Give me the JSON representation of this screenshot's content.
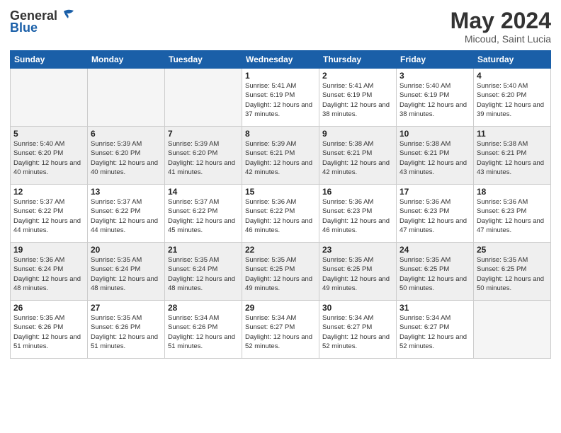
{
  "header": {
    "logo_general": "General",
    "logo_blue": "Blue",
    "month_title": "May 2024",
    "location": "Micoud, Saint Lucia"
  },
  "days_of_week": [
    "Sunday",
    "Monday",
    "Tuesday",
    "Wednesday",
    "Thursday",
    "Friday",
    "Saturday"
  ],
  "weeks": [
    [
      {
        "day": "",
        "info": ""
      },
      {
        "day": "",
        "info": ""
      },
      {
        "day": "",
        "info": ""
      },
      {
        "day": "1",
        "sunrise": "5:41 AM",
        "sunset": "6:19 PM",
        "daylight": "12 hours and 37 minutes."
      },
      {
        "day": "2",
        "sunrise": "5:41 AM",
        "sunset": "6:19 PM",
        "daylight": "12 hours and 38 minutes."
      },
      {
        "day": "3",
        "sunrise": "5:40 AM",
        "sunset": "6:19 PM",
        "daylight": "12 hours and 38 minutes."
      },
      {
        "day": "4",
        "sunrise": "5:40 AM",
        "sunset": "6:20 PM",
        "daylight": "12 hours and 39 minutes."
      }
    ],
    [
      {
        "day": "5",
        "sunrise": "5:40 AM",
        "sunset": "6:20 PM",
        "daylight": "12 hours and 40 minutes."
      },
      {
        "day": "6",
        "sunrise": "5:39 AM",
        "sunset": "6:20 PM",
        "daylight": "12 hours and 40 minutes."
      },
      {
        "day": "7",
        "sunrise": "5:39 AM",
        "sunset": "6:20 PM",
        "daylight": "12 hours and 41 minutes."
      },
      {
        "day": "8",
        "sunrise": "5:39 AM",
        "sunset": "6:21 PM",
        "daylight": "12 hours and 42 minutes."
      },
      {
        "day": "9",
        "sunrise": "5:38 AM",
        "sunset": "6:21 PM",
        "daylight": "12 hours and 42 minutes."
      },
      {
        "day": "10",
        "sunrise": "5:38 AM",
        "sunset": "6:21 PM",
        "daylight": "12 hours and 43 minutes."
      },
      {
        "day": "11",
        "sunrise": "5:38 AM",
        "sunset": "6:21 PM",
        "daylight": "12 hours and 43 minutes."
      }
    ],
    [
      {
        "day": "12",
        "sunrise": "5:37 AM",
        "sunset": "6:22 PM",
        "daylight": "12 hours and 44 minutes."
      },
      {
        "day": "13",
        "sunrise": "5:37 AM",
        "sunset": "6:22 PM",
        "daylight": "12 hours and 44 minutes."
      },
      {
        "day": "14",
        "sunrise": "5:37 AM",
        "sunset": "6:22 PM",
        "daylight": "12 hours and 45 minutes."
      },
      {
        "day": "15",
        "sunrise": "5:36 AM",
        "sunset": "6:22 PM",
        "daylight": "12 hours and 46 minutes."
      },
      {
        "day": "16",
        "sunrise": "5:36 AM",
        "sunset": "6:23 PM",
        "daylight": "12 hours and 46 minutes."
      },
      {
        "day": "17",
        "sunrise": "5:36 AM",
        "sunset": "6:23 PM",
        "daylight": "12 hours and 47 minutes."
      },
      {
        "day": "18",
        "sunrise": "5:36 AM",
        "sunset": "6:23 PM",
        "daylight": "12 hours and 47 minutes."
      }
    ],
    [
      {
        "day": "19",
        "sunrise": "5:36 AM",
        "sunset": "6:24 PM",
        "daylight": "12 hours and 48 minutes."
      },
      {
        "day": "20",
        "sunrise": "5:35 AM",
        "sunset": "6:24 PM",
        "daylight": "12 hours and 48 minutes."
      },
      {
        "day": "21",
        "sunrise": "5:35 AM",
        "sunset": "6:24 PM",
        "daylight": "12 hours and 48 minutes."
      },
      {
        "day": "22",
        "sunrise": "5:35 AM",
        "sunset": "6:25 PM",
        "daylight": "12 hours and 49 minutes."
      },
      {
        "day": "23",
        "sunrise": "5:35 AM",
        "sunset": "6:25 PM",
        "daylight": "12 hours and 49 minutes."
      },
      {
        "day": "24",
        "sunrise": "5:35 AM",
        "sunset": "6:25 PM",
        "daylight": "12 hours and 50 minutes."
      },
      {
        "day": "25",
        "sunrise": "5:35 AM",
        "sunset": "6:25 PM",
        "daylight": "12 hours and 50 minutes."
      }
    ],
    [
      {
        "day": "26",
        "sunrise": "5:35 AM",
        "sunset": "6:26 PM",
        "daylight": "12 hours and 51 minutes."
      },
      {
        "day": "27",
        "sunrise": "5:35 AM",
        "sunset": "6:26 PM",
        "daylight": "12 hours and 51 minutes."
      },
      {
        "day": "28",
        "sunrise": "5:34 AM",
        "sunset": "6:26 PM",
        "daylight": "12 hours and 51 minutes."
      },
      {
        "day": "29",
        "sunrise": "5:34 AM",
        "sunset": "6:27 PM",
        "daylight": "12 hours and 52 minutes."
      },
      {
        "day": "30",
        "sunrise": "5:34 AM",
        "sunset": "6:27 PM",
        "daylight": "12 hours and 52 minutes."
      },
      {
        "day": "31",
        "sunrise": "5:34 AM",
        "sunset": "6:27 PM",
        "daylight": "12 hours and 52 minutes."
      },
      {
        "day": "",
        "info": ""
      }
    ]
  ]
}
